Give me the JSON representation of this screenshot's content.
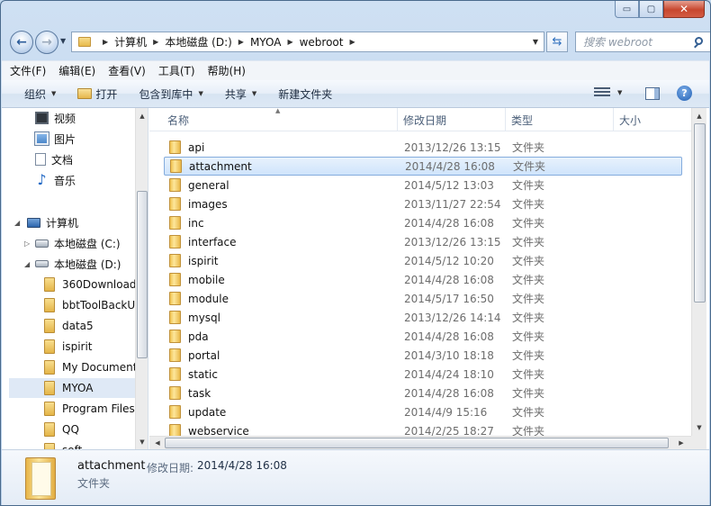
{
  "window": {
    "minimize_glyph": "▭",
    "maximize_glyph": "▢",
    "close_glyph": "✕"
  },
  "address_bar": {
    "crumbs": [
      "计算机",
      "本地磁盘 (D:)",
      "MYOA",
      "webroot"
    ]
  },
  "search": {
    "placeholder": "搜索 webroot"
  },
  "menu": [
    "文件(F)",
    "编辑(E)",
    "查看(V)",
    "工具(T)",
    "帮助(H)"
  ],
  "toolbar": {
    "organize": "组织",
    "open": "打开",
    "include_in_library": "包含到库中",
    "share": "共享",
    "new_folder": "新建文件夹"
  },
  "nav": {
    "video": "视频",
    "pictures": "图片",
    "documents": "文档",
    "music": "音乐",
    "computer": "计算机",
    "drive_c": "本地磁盘 (C:)",
    "drive_d": "本地磁盘 (D:)",
    "folders": [
      "360Download",
      "bbtToolBackU",
      "data5",
      "ispirit",
      "My Document",
      "MYOA",
      "Program Files",
      "QQ",
      "soft"
    ],
    "selected_folder": "MYOA"
  },
  "columns": {
    "name": "名称",
    "date": "修改日期",
    "type": "类型",
    "size": "大小"
  },
  "files": [
    {
      "name": "api",
      "date": "2013/12/26 13:15",
      "type": "文件夹"
    },
    {
      "name": "attachment",
      "date": "2014/4/28 16:08",
      "type": "文件夹",
      "selected": true
    },
    {
      "name": "general",
      "date": "2014/5/12 13:03",
      "type": "文件夹"
    },
    {
      "name": "images",
      "date": "2013/11/27 22:54",
      "type": "文件夹"
    },
    {
      "name": "inc",
      "date": "2014/4/28 16:08",
      "type": "文件夹"
    },
    {
      "name": "interface",
      "date": "2013/12/26 13:15",
      "type": "文件夹"
    },
    {
      "name": "ispirit",
      "date": "2014/5/12 10:20",
      "type": "文件夹"
    },
    {
      "name": "mobile",
      "date": "2014/4/28 16:08",
      "type": "文件夹"
    },
    {
      "name": "module",
      "date": "2014/5/17 16:50",
      "type": "文件夹"
    },
    {
      "name": "mysql",
      "date": "2013/12/26 14:14",
      "type": "文件夹"
    },
    {
      "name": "pda",
      "date": "2014/4/28 16:08",
      "type": "文件夹"
    },
    {
      "name": "portal",
      "date": "2014/3/10 18:18",
      "type": "文件夹"
    },
    {
      "name": "static",
      "date": "2014/4/24 18:10",
      "type": "文件夹"
    },
    {
      "name": "task",
      "date": "2014/4/28 16:08",
      "type": "文件夹"
    },
    {
      "name": "update",
      "date": "2014/4/9 15:16",
      "type": "文件夹"
    },
    {
      "name": "webservice",
      "date": "2014/2/25 18:27",
      "type": "文件夹"
    }
  ],
  "details": {
    "name": "attachment",
    "date_label": "修改日期:",
    "date": "2014/4/28 16:08",
    "type": "文件夹"
  },
  "icons": {
    "back": "back-arrow-icon",
    "forward": "forward-arrow-icon",
    "refresh": "refresh-icon",
    "search": "search-icon",
    "help": "help-icon"
  }
}
